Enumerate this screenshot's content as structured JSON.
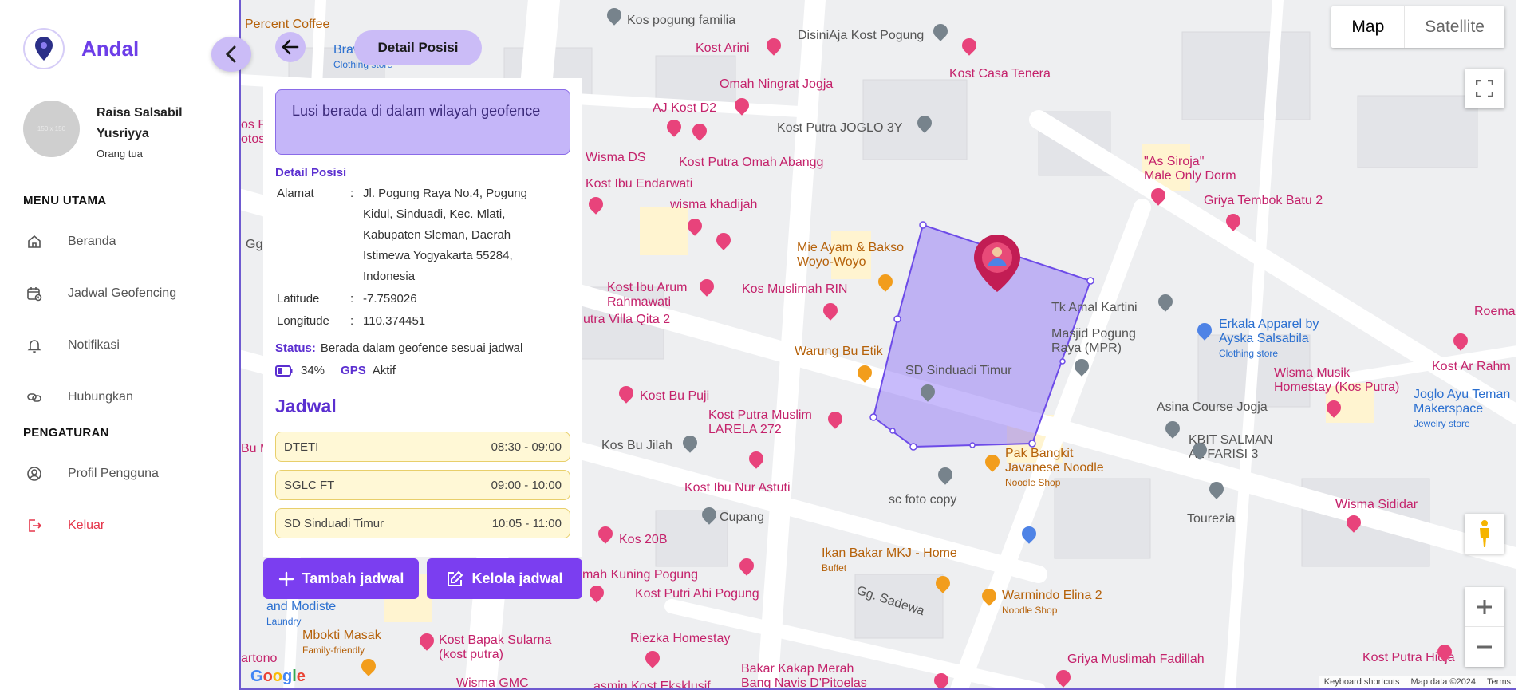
{
  "app": {
    "name": "Andal"
  },
  "user": {
    "name": "Raisa Salsabil Yusriyya",
    "role": "Orang tua",
    "avatar_placeholder": "150 x 150"
  },
  "nav": {
    "main_title": "MENU UTAMA",
    "items": [
      {
        "label": "Beranda",
        "icon": "home-icon"
      },
      {
        "label": "Jadwal Geofencing",
        "icon": "calendar-clock-icon"
      },
      {
        "label": "Notifikasi",
        "icon": "bell-icon"
      },
      {
        "label": "Hubungkan",
        "icon": "link-icon"
      }
    ],
    "settings_title": "PENGATURAN",
    "settings_items": [
      {
        "label": "Profil Pengguna",
        "icon": "user-circle-icon"
      },
      {
        "label": "Keluar",
        "icon": "logout-icon"
      }
    ]
  },
  "panel": {
    "title": "Detail Posisi",
    "alert": "Lusi berada di dalam wilayah geofence",
    "section_title": "Detail Posisi",
    "address_label": "Alamat",
    "address": "Jl. Pogung Raya No.4, Pogung Kidul, Sinduadi, Kec. Mlati, Kabupaten Sleman, Daerah Istimewa Yogyakarta 55284, Indonesia",
    "latitude_label": "Latitude",
    "latitude": "-7.759026",
    "longitude_label": "Longitude",
    "longitude": "110.374451",
    "separator": ":",
    "status_label": "Status:",
    "status": "Berada dalam geofence sesuai jadwal",
    "battery": "34%",
    "gps_label": "GPS",
    "gps_status": "Aktif",
    "jadwal_title": "Jadwal",
    "schedules": [
      {
        "name": "DTETI",
        "time": "08:30 - 09:00"
      },
      {
        "name": "SGLC FT",
        "time": "09:00 - 10:00"
      },
      {
        "name": "SD Sinduadi Timur",
        "time": "10:05 - 11:00"
      }
    ],
    "add_button": "Tambah jadwal",
    "manage_button": "Kelola jadwal"
  },
  "map": {
    "type_map": "Map",
    "type_satellite": "Satellite",
    "logo": "Google",
    "attribution": {
      "shortcuts": "Keyboard shortcuts",
      "data": "Map data ©2024",
      "terms": "Terms"
    },
    "pois": {
      "p1": "Percent Coffee",
      "p2": "Kos pogung familia",
      "p3": "DisiniAja Kost Pogung",
      "p4": "Kost Arini",
      "p5": "Kost Casa Tenera",
      "p6": "Omah Ningrat Jogja",
      "p7": "AJ Kost D2",
      "p8": "Kost Putra JOGLO 3Y",
      "p9": "Wisma DS",
      "p10": "Kost Putra Omah Abangg",
      "p11": "\"As Siroja\"",
      "p11b": "Male Only Dorm",
      "p12": "Kost Ibu Endarwati",
      "p13": "Griya Tembok Batu 2",
      "p14": "wisma khadijah",
      "p15": "Mie Ayam & Bakso",
      "p15b": "Woyo-Woyo",
      "p16": "Kost Ibu Arum",
      "p16b": "Rahmawati",
      "p17": "Kos Muslimah RIN",
      "p18": "Tk Amal Kartini",
      "p19": "Erkala Apparel by",
      "p19b": "Ayska Salsabila",
      "p19c": "Clothing store",
      "p20": "Roema",
      "p21": "utra Villa Qita 2",
      "p22": "Masjid Pogung",
      "p22b": "Raya (MPR)",
      "p23": "Warung Bu Etik",
      "p24": "SD Sinduadi Timur",
      "p25": "Wisma Musik",
      "p25b": "Homestay (Kos Putra)",
      "p26": "Kost Ar Rahm",
      "p27": "Kost Bu Puji",
      "p28": "Asina Course Jogja",
      "p29": "Joglo Ayu Teman",
      "p29b": "Makerspace",
      "p29c": "Jewelry store",
      "p30": "Kost Putra Muslim",
      "p30b": "LARELA 272",
      "p31": "Kos Bu Jilah",
      "p32": "KBIT SALMAN",
      "p32b": "AL FARISI 3",
      "p33": "Pak Bangkit",
      "p33b": "Javanese Noodle",
      "p33c": "Noodle Shop",
      "p34": "Kost Ibu Nur Astuti",
      "p35": "sc foto copy",
      "p36": "Tourezia",
      "p37": "Wisma Sididar",
      "p38": "Cupang",
      "p39": "Kos 20B",
      "p40": "Ikan Bakar MKJ - Home",
      "p40b": "Buffet",
      "p41": "mah Kuning Pogung",
      "p42": "Kost Putri Abi Pogung",
      "p43": "Gg. Sadewa",
      "p44": "Warmindo Elina 2",
      "p44b": "Noodle Shop",
      "p45": "Mbokti Masak",
      "p45b": "Family-friendly",
      "p46": "Kost Bapak Sularna",
      "p46b": "(kost putra)",
      "p47": "Riezka Homestay",
      "p48": "Bakar Kakap Merah",
      "p48b": "Bang Navis D'Pitoelas",
      "p49": "Griya Muslimah Fadillah",
      "p50": "Kost Putra Hidja",
      "p51": "Wisma GMC",
      "p52": "asmin Kost Eksklusif",
      "p53": "artono",
      "p54": "and Modiste",
      "p54b": "Laundry",
      "p55": "Brawler",
      "p55b": "Clothing store",
      "p56": "Gg.",
      "p57": "Bu M",
      "p58": "os P",
      "p58b": "otos"
    }
  }
}
